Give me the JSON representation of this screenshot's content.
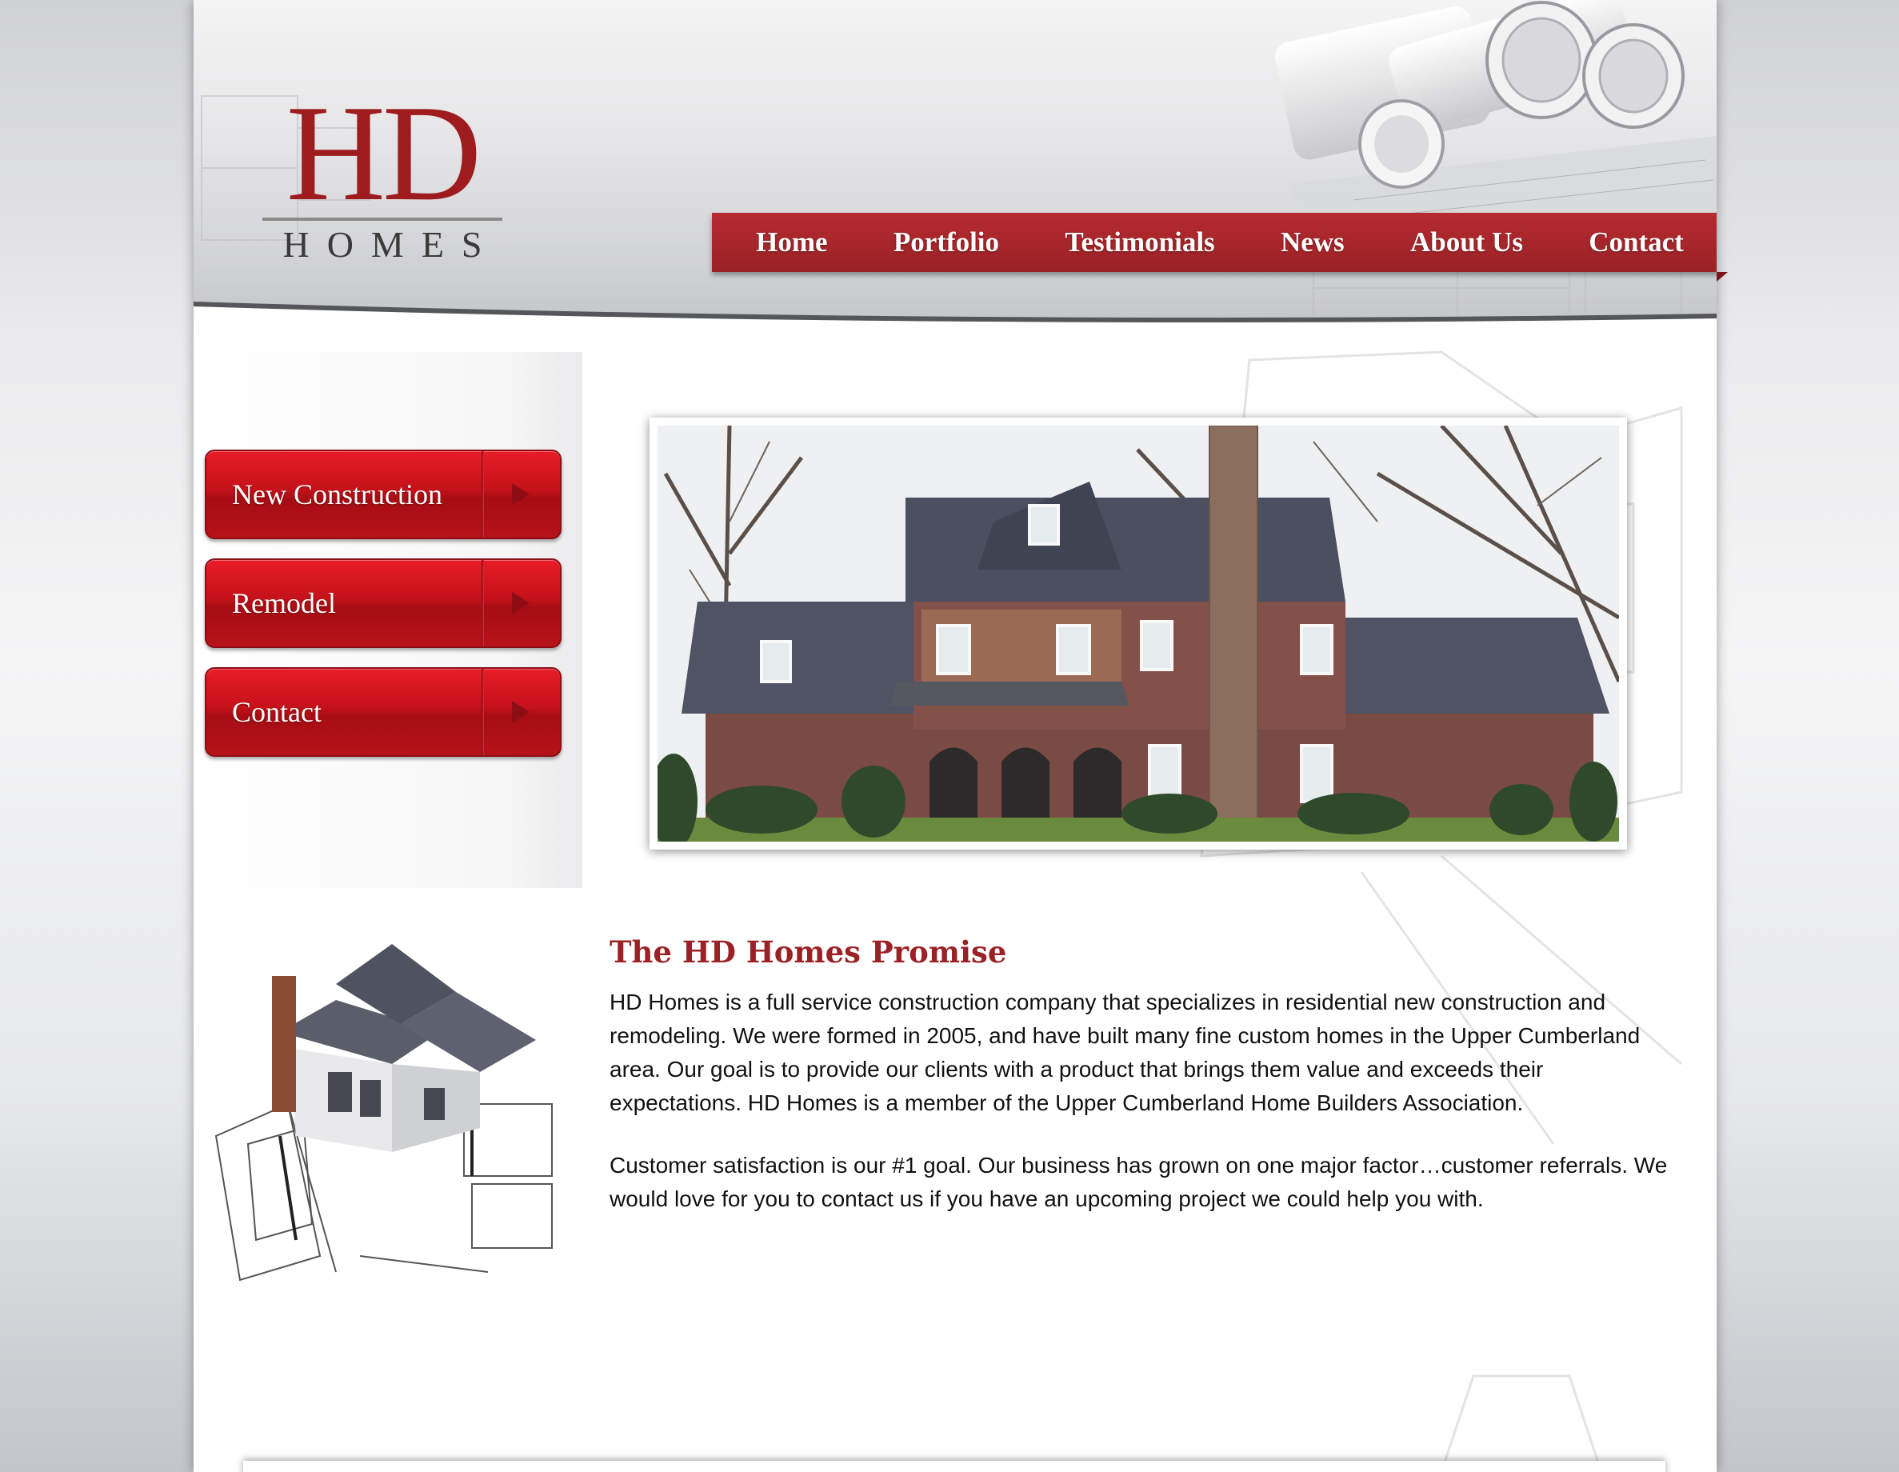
{
  "brand": {
    "logo_main": "HD",
    "logo_sub": "HOMES",
    "accent": "#9e1b1e"
  },
  "nav": {
    "items": [
      {
        "label": "Home"
      },
      {
        "label": "Portfolio"
      },
      {
        "label": "Testimonials"
      },
      {
        "label": "News"
      },
      {
        "label": "About Us"
      },
      {
        "label": "Contact"
      }
    ]
  },
  "sidebar": {
    "items": [
      {
        "label": "New Construction",
        "icon": "play-arrow-icon"
      },
      {
        "label": "Remodel",
        "icon": "play-arrow-icon"
      },
      {
        "label": "Contact",
        "icon": "play-arrow-icon"
      }
    ]
  },
  "main": {
    "promise_title": "The HD Homes Promise",
    "paragraph1": "HD Homes is a full service construction company that specializes in residential new construction and remodeling. We were formed in 2005, and have built many fine custom homes in the Upper Cumberland area. Our goal is to provide our clients with a product that brings them value and exceeds their expectations. HD Homes is a member of the Upper Cumberland Home Builders Association.",
    "paragraph2": "Customer satisfaction is our #1 goal. Our business has grown on one major factor…customer referrals. We would love for you to contact us if you have an upcoming project we could help you with."
  }
}
